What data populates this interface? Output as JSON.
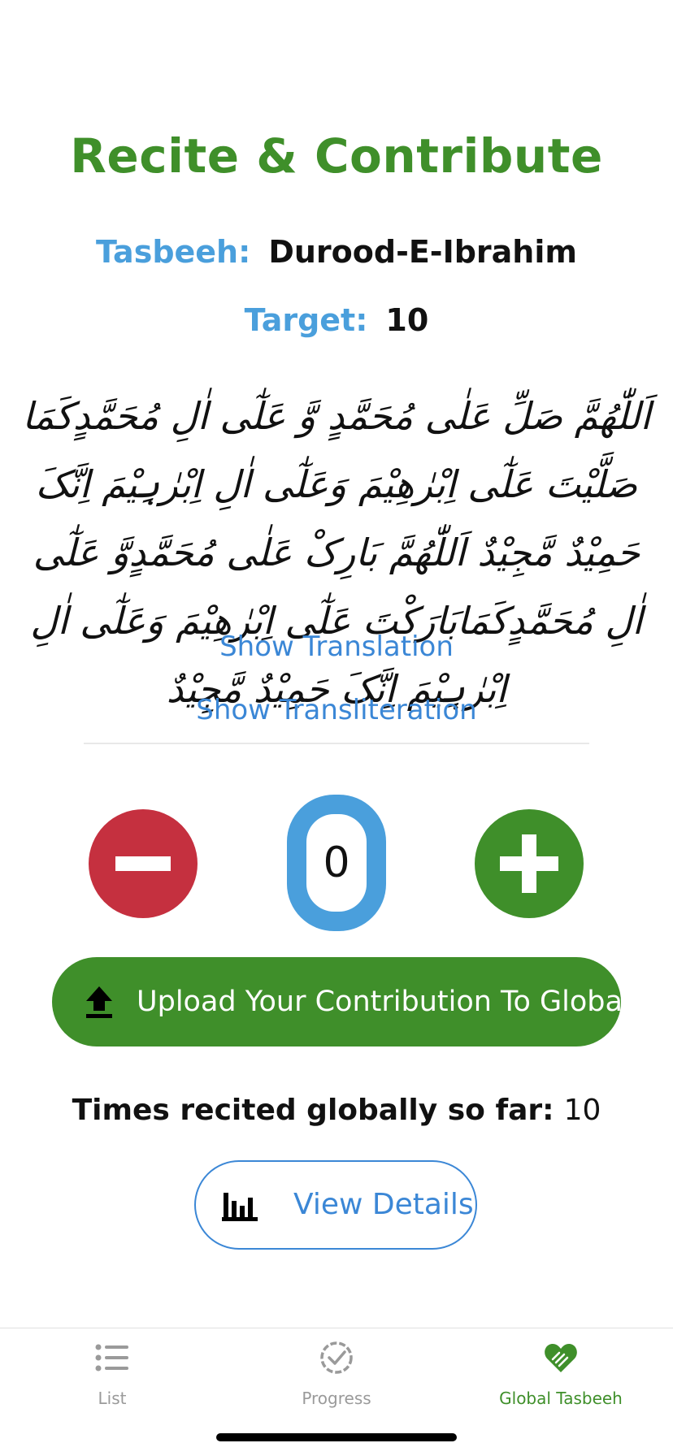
{
  "header": {
    "title": "Recite & Contribute"
  },
  "tasbeeh": {
    "label": "Tasbeeh:",
    "name": "Durood-E-Ibrahim"
  },
  "target": {
    "label": "Target:",
    "value": "10"
  },
  "arabic_text": "اَللّٰھُمَّ صَلِّ عَلٰی مُحَمَّدٍ وَّ عَلٰٓی اٰلِ مُحَمَّدٍکَمَا صَلَّیْتَ عَلٰٓی اِبْرٰھِیْمَ وَعَلٰٓی اٰلِ اِبْرٰہِیْمَ اِنَّکَ حَمِیْدٌ مَّجِیْدٌ اَللّٰھُمَّ بَارِکْ عَلٰی مُحَمَّدٍوَّ عَلٰٓی اٰلِ مُحَمَّدٍکَمَابَارَکْتَ عَلٰٓی اِبْرٰھِیْمَ وَعَلٰٓی اٰلِ اِبْرٰہِیْمَ اِنَّکَ حَمِیْدٌ مَّجِیْدٌ",
  "links": {
    "show_translation": "Show Translation",
    "show_transliteration": "Show Transliteration"
  },
  "counter": {
    "value": "0"
  },
  "upload": {
    "label": "Upload Your Contribution To Global",
    "icon": "upload-icon"
  },
  "global": {
    "label": "Times recited globally so far:",
    "value": "10"
  },
  "details": {
    "label": "View Details",
    "icon": "bar-chart-icon"
  },
  "tabs": [
    {
      "label": "List",
      "icon": "list-icon"
    },
    {
      "label": "Progress",
      "icon": "progress-check-icon"
    },
    {
      "label": "Global Tasbeeh",
      "icon": "global-heart-icon"
    }
  ],
  "colors": {
    "primary_green": "#3f8f2a",
    "accent_blue": "#4a9fdc",
    "link_blue": "#3b87d6",
    "minus_red": "#c5303f",
    "inactive_gray": "#9a9a9a"
  }
}
